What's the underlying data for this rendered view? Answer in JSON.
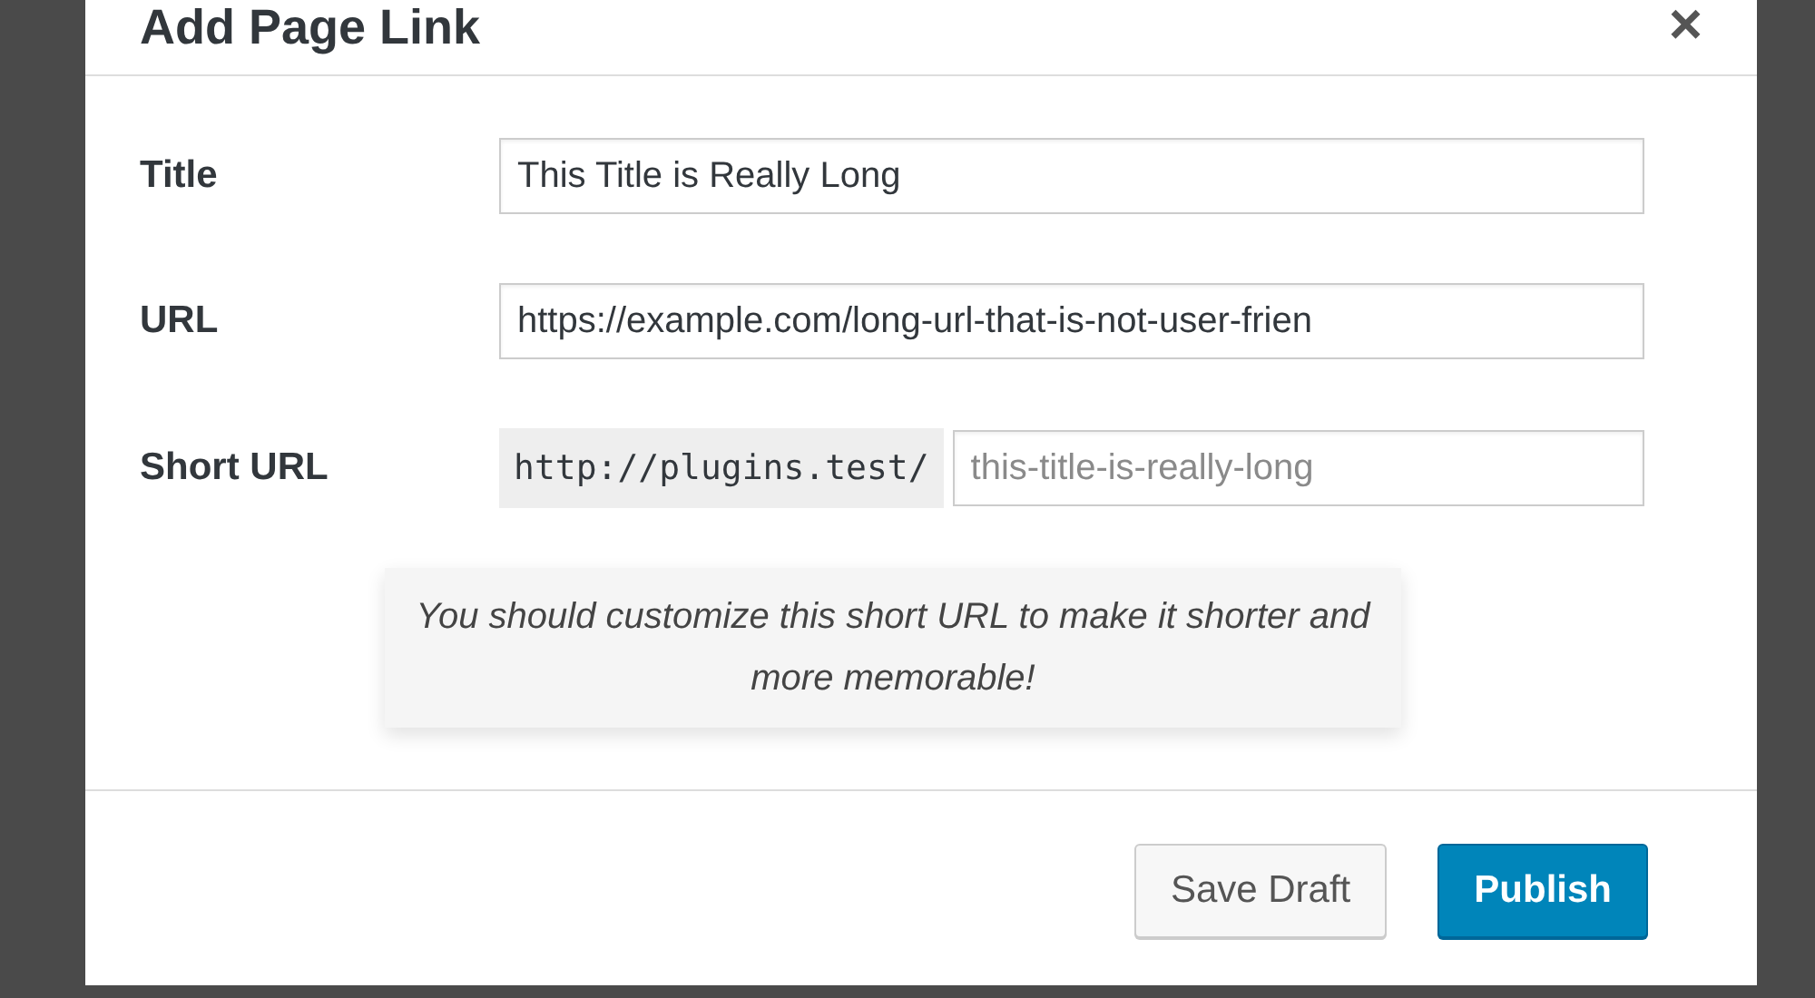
{
  "dialog": {
    "title": "Add Page Link",
    "close": "×"
  },
  "fields": [
    {
      "kind": "text",
      "label": "Title",
      "value": "This Title is Really Long"
    },
    {
      "kind": "text",
      "label": "URL",
      "value": "https://example.com/long-url-that-is-not-user-frien"
    },
    {
      "kind": "prefixed",
      "label": "Short URL",
      "prefix": "http://plugins.test/",
      "placeholder": "this-title-is-really-long"
    }
  ],
  "hint": "You should customize this short URL to make it shorter and more memorable!",
  "buttons": [
    {
      "label": "Save Draft",
      "kind": "secondary"
    },
    {
      "label": "Publish",
      "kind": "primary"
    }
  ]
}
